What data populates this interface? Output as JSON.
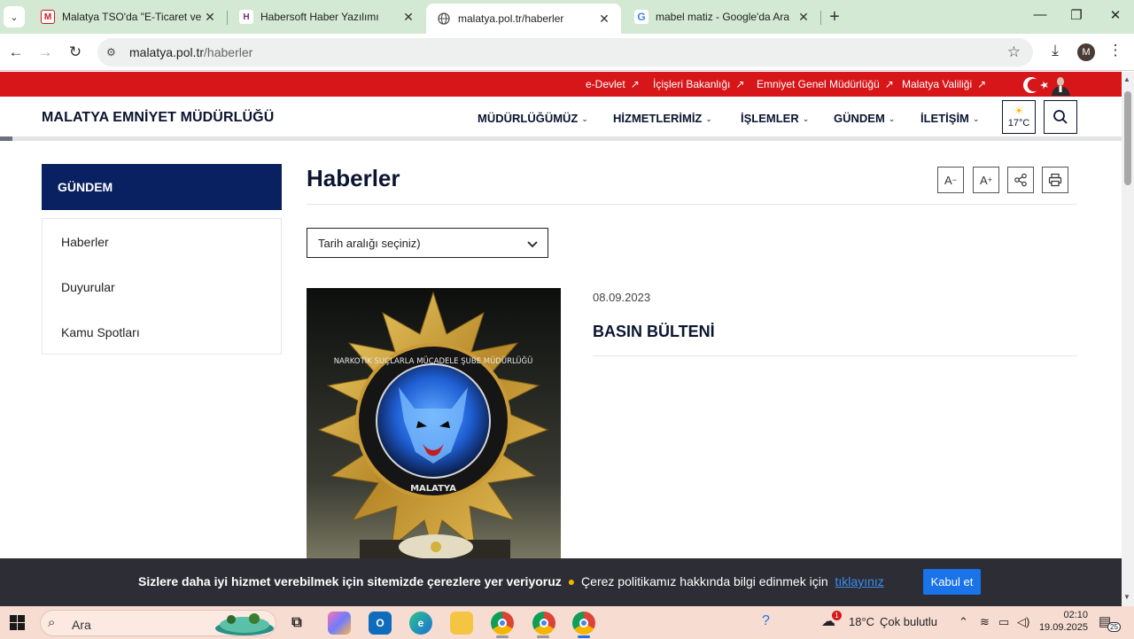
{
  "browser": {
    "tabs": [
      {
        "title": "Malatya TSO'da \"E-Ticaret ve Ye",
        "favicon": "mtso-logo-icon",
        "active": false
      },
      {
        "title": "Habersoft Haber Yazılımı",
        "favicon": "habersoft-logo-icon",
        "active": false
      },
      {
        "title": "malatya.pol.tr/haberler",
        "favicon": "globe-icon",
        "active": true
      },
      {
        "title": "mabel matiz - Google'da Ara",
        "favicon": "google-logo-icon",
        "active": false
      }
    ],
    "url_host": "malatya.pol.tr",
    "url_path": "/haberler",
    "profile_initial": "M"
  },
  "site": {
    "top_links": [
      "e-Devlet",
      "İçişleri Bakanlığı",
      "Emniyet Genel Müdürlüğü",
      "Malatya Valiliği"
    ],
    "title": "MALATYA EMNİYET MÜDÜRLÜĞÜ",
    "menu": [
      "MÜDÜRLÜĞÜMÜZ",
      "HİZMETLERİMİZ",
      "İŞLEMLER",
      "GÜNDEM",
      "İLETİŞİM"
    ],
    "weather_temp": "17°C"
  },
  "sidebar": {
    "heading": "GÜNDEM",
    "items": [
      "Haberler",
      "Duyurular",
      "Kamu Spotları"
    ]
  },
  "main": {
    "title": "Haberler",
    "tools": {
      "decrease": "A",
      "decrease_mark": "−",
      "increase": "A",
      "increase_mark": "+"
    },
    "date_select_value": "Tarih aralığı seçiniz)",
    "news": [
      {
        "date": "08.09.2023",
        "title": "BASIN BÜLTENİ",
        "image": "narkotik-badge-image"
      }
    ]
  },
  "image_text": {
    "badge_ring": "NARKOTİK SUÇLARLA MÜCADELE ŞUBE MÜDÜRLÜĞÜ",
    "badge_city": "MALATYA"
  },
  "cookie": {
    "message_bold": "Sizlere daha iyi hizmet verebilmek için sitemizde çerezlere yer veriyoruz",
    "message": "Çerez politikamız hakkında bilgi edinmek için",
    "link": "tıklayınız",
    "accept": "Kabul et"
  },
  "taskbar": {
    "search_label": "Ara",
    "weather": "18°C",
    "weather_desc": "Çok bulutlu",
    "time": "02:10",
    "date": "19.09.2025",
    "notification_count": "25",
    "weather_badge": "1"
  },
  "colors": {
    "red_bar": "#d7161a",
    "navy": "#0a2161",
    "accept": "#1a73e8",
    "taskbar": "#f7dcd2",
    "tabstrip": "#d3e9d3"
  }
}
